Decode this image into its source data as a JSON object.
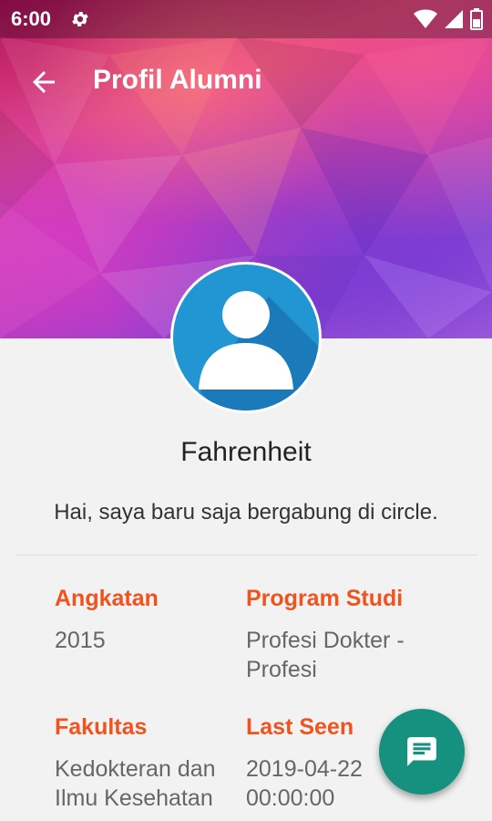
{
  "status_bar": {
    "time": "6:00"
  },
  "app_bar": {
    "title": "Profil Alumni"
  },
  "profile": {
    "name": "Fahrenheit",
    "bio": "Hai, saya baru saja bergabung di circle."
  },
  "details": {
    "angkatan": {
      "label": "Angkatan",
      "value": "2015"
    },
    "program_studi": {
      "label": "Program Studi",
      "value_line1": "Profesi Dokter -",
      "value_line2": "Profesi"
    },
    "fakultas": {
      "label": "Fakultas",
      "value_line1": "Kedokteran dan",
      "value_line2": "Ilmu Kesehatan"
    },
    "last_seen": {
      "label": "Last Seen",
      "value_line1": "2019-04-22",
      "value_line2": "00:00:00"
    }
  },
  "colors": {
    "label_accent": "#f0531d",
    "fab": "#16917f",
    "avatar_bg": "#2196d3"
  },
  "icons": {
    "gear": "gear-icon",
    "wifi": "wifi-icon",
    "signal": "signal-icon",
    "battery": "battery-icon",
    "back": "arrow-back-icon",
    "avatar": "person-icon",
    "fab": "chat-message-icon"
  }
}
